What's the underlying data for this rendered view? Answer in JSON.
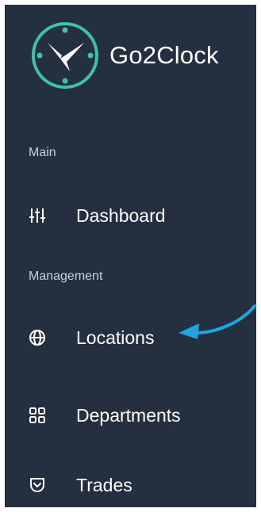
{
  "brand": {
    "name": "Go2Clock",
    "logo_icon": "clock-logo-icon",
    "accent_color": "#3FC1B0"
  },
  "sections": {
    "main_label": "Main",
    "management_label": "Management"
  },
  "nav": {
    "dashboard": {
      "label": "Dashboard",
      "icon": "sliders-icon"
    },
    "locations": {
      "label": "Locations",
      "icon": "globe-icon"
    },
    "departments": {
      "label": "Departments",
      "icon": "grid-icon"
    },
    "trades": {
      "label": "Trades",
      "icon": "pocket-icon"
    }
  },
  "colors": {
    "sidebar_bg": "#243040",
    "text": "#FFFFFF",
    "muted_text": "#C9D0D8",
    "annotation_arrow": "#1BA7DF"
  }
}
